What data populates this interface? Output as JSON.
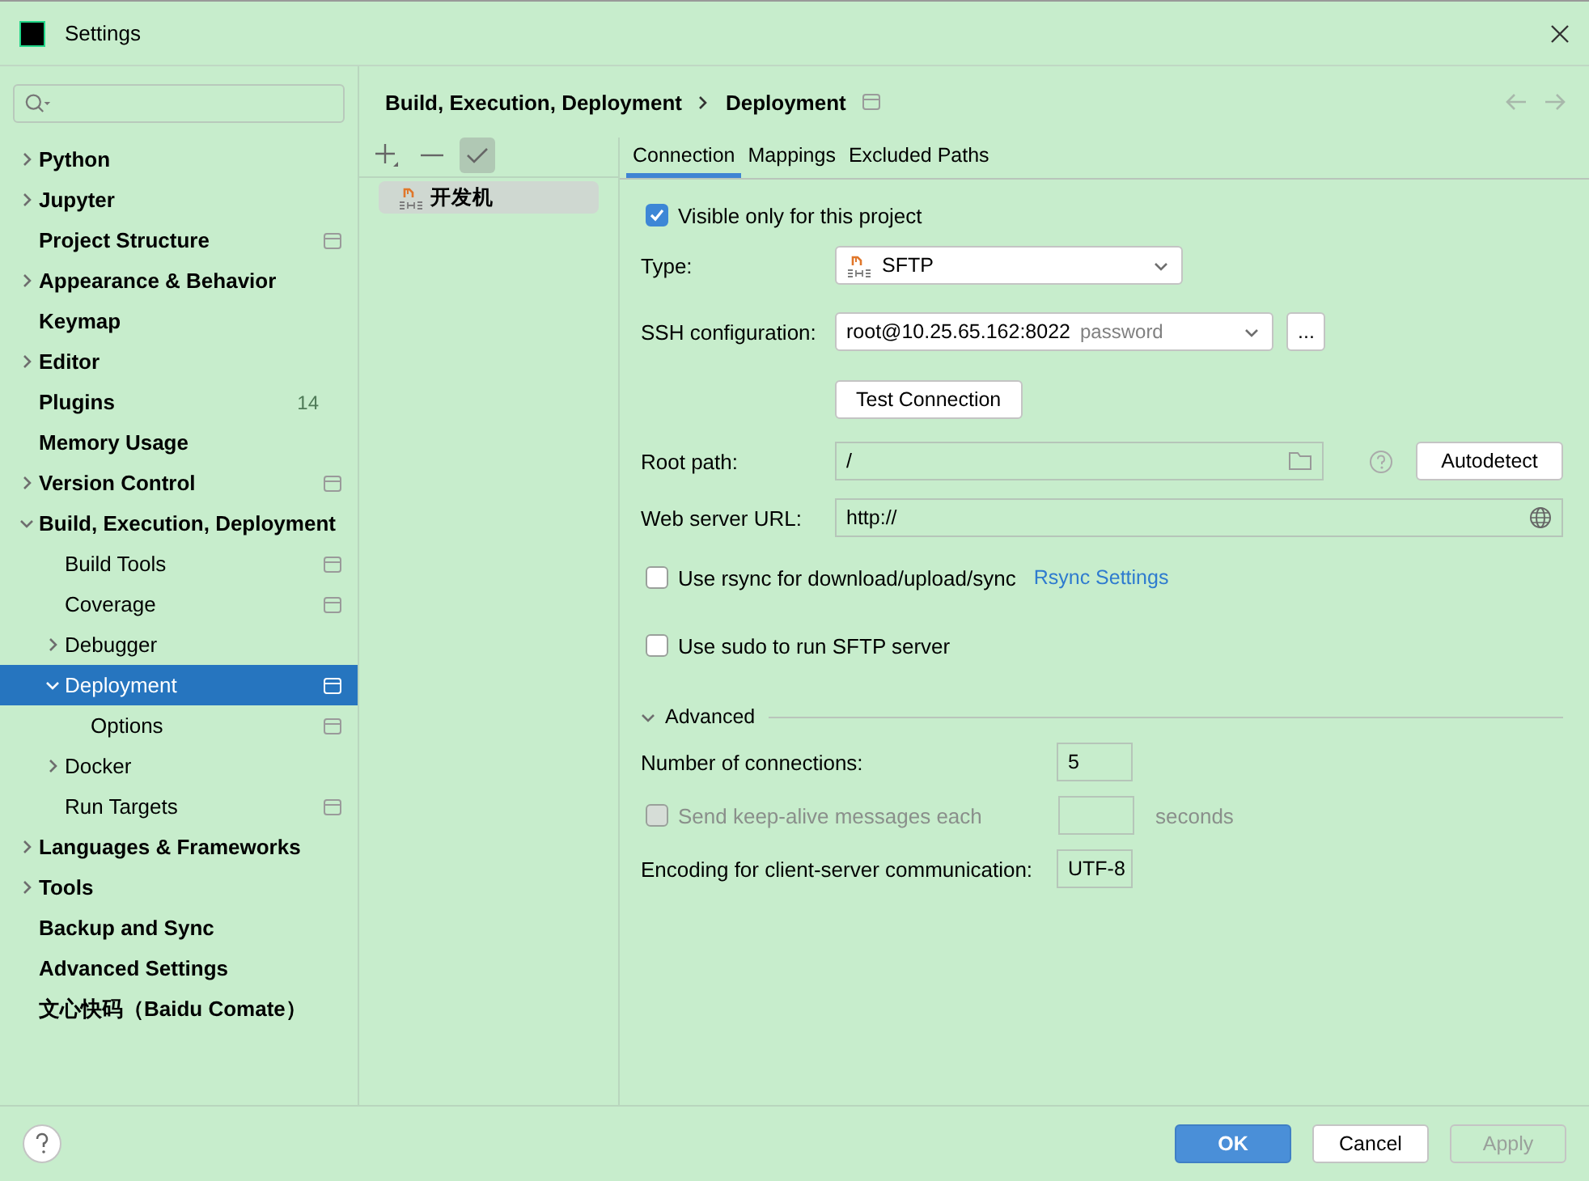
{
  "window": {
    "title": "Settings"
  },
  "sidebar": {
    "items": [
      {
        "label": "Python",
        "expanded": false,
        "bold": true
      },
      {
        "label": "Jupyter",
        "expanded": false,
        "bold": true
      },
      {
        "label": "Project Structure",
        "bold": true,
        "project_scoped": true
      },
      {
        "label": "Appearance & Behavior",
        "expanded": false,
        "bold": true
      },
      {
        "label": "Keymap",
        "bold": true
      },
      {
        "label": "Editor",
        "expanded": false,
        "bold": true
      },
      {
        "label": "Plugins",
        "bold": true,
        "count": "14"
      },
      {
        "label": "Memory Usage",
        "bold": true
      },
      {
        "label": "Version Control",
        "expanded": false,
        "bold": true,
        "project_scoped": true
      },
      {
        "label": "Build, Execution, Deployment",
        "expanded": true,
        "bold": true,
        "children": [
          {
            "label": "Build Tools",
            "project_scoped": true
          },
          {
            "label": "Coverage",
            "project_scoped": true
          },
          {
            "label": "Debugger",
            "expanded": false
          },
          {
            "label": "Deployment",
            "expanded": true,
            "selected": true,
            "project_scoped": true,
            "children": [
              {
                "label": "Options",
                "project_scoped": true
              }
            ]
          },
          {
            "label": "Docker",
            "expanded": false
          },
          {
            "label": "Run Targets",
            "project_scoped": true
          }
        ]
      },
      {
        "label": "Languages & Frameworks",
        "expanded": false,
        "bold": true
      },
      {
        "label": "Tools",
        "expanded": false,
        "bold": true
      },
      {
        "label": "Backup and Sync",
        "bold": true
      },
      {
        "label": "Advanced Settings",
        "bold": true
      },
      {
        "label": "文心快码（Baidu Comate）",
        "bold": true
      }
    ]
  },
  "breadcrumb": [
    "Build, Execution, Deployment",
    "Deployment"
  ],
  "servers": [
    {
      "name": "开发机",
      "selected": true
    }
  ],
  "tabs": [
    {
      "label": "Connection",
      "selected": true
    },
    {
      "label": "Mappings",
      "selected": false
    },
    {
      "label": "Excluded Paths",
      "selected": false
    }
  ],
  "connection": {
    "visible_only": {
      "label": "Visible only for this project",
      "checked": true
    },
    "type": {
      "label": "Type:",
      "value": "SFTP"
    },
    "ssh": {
      "label": "SSH configuration:",
      "value": "root@10.25.65.162:8022",
      "hint": "password",
      "more": "..."
    },
    "test_button": "Test Connection",
    "root_path": {
      "label": "Root path:",
      "value": "/",
      "button": "Autodetect"
    },
    "web_url": {
      "label": "Web server URL:",
      "value": "http://"
    },
    "rsync": {
      "label": "Use rsync for download/upload/sync",
      "checked": false,
      "link": "Rsync Settings"
    },
    "sudo": {
      "label": "Use sudo to run SFTP server",
      "checked": false
    },
    "advanced": {
      "label": "Advanced",
      "expanded": true,
      "connections": {
        "label": "Number of connections:",
        "value": "5"
      },
      "keepalive": {
        "label": "Send keep-alive messages each",
        "checked": false,
        "disabled": true,
        "unit": "seconds"
      },
      "encoding": {
        "label": "Encoding for client-server communication:",
        "value": "UTF-8"
      }
    }
  },
  "buttons": [
    {
      "label": "OK",
      "kind": "primary",
      "disabled": false
    },
    {
      "label": "Cancel",
      "kind": "normal",
      "disabled": false
    },
    {
      "label": "Apply",
      "kind": "normal",
      "disabled": true
    }
  ]
}
